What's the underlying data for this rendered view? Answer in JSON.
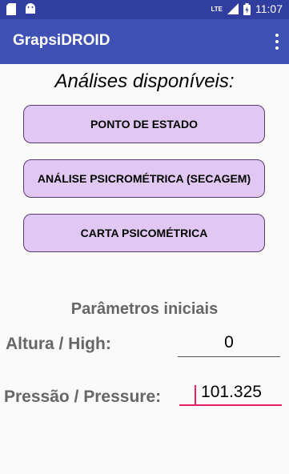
{
  "status_bar": {
    "time": "11:07",
    "icons": [
      "sd-card-icon",
      "android-icon",
      "lte-signal-icon",
      "battery-icon"
    ],
    "network": "LTE"
  },
  "app_bar": {
    "title": "GrapsiDROID",
    "menu_icon": "overflow-menu-icon"
  },
  "main": {
    "heading": "Análises disponíveis:",
    "buttons": [
      {
        "label": "PONTO DE ESTADO"
      },
      {
        "label": "ANÁLISE PSICROMÉTRICA (SECAGEM)"
      },
      {
        "label": "CARTA PSICOMÉTRICA"
      }
    ],
    "params_title": "Parâmetros iniciais",
    "altura": {
      "label": "Altura / High:",
      "value": "0"
    },
    "pressao": {
      "label": "Pressão / Pressure:",
      "value": "101.325"
    }
  },
  "colors": {
    "status_bar": "#303F9F",
    "app_bar": "#3F51B5",
    "button_bg": "#E1C8F2",
    "accent": "#E91E63"
  }
}
